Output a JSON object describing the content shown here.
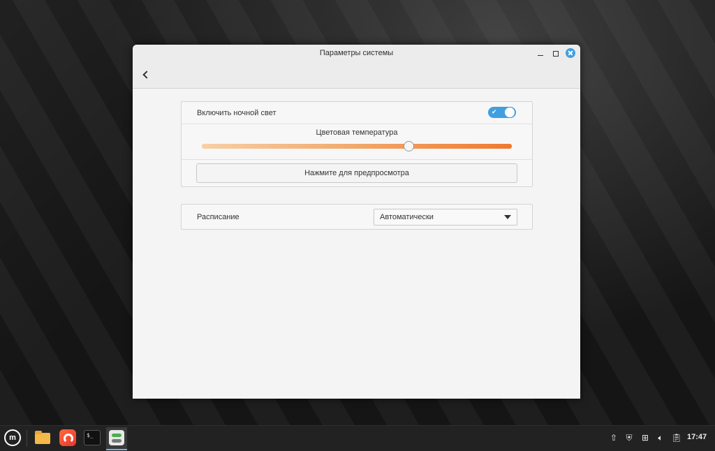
{
  "window": {
    "title": "Параметры системы",
    "minimize_icon": "minimize-icon",
    "maximize_icon": "maximize-icon",
    "close_icon": "close-icon",
    "back_icon": "chevron-left-icon"
  },
  "night_light": {
    "enable_label": "Включить ночной свет",
    "enabled": true,
    "toggle_check_icon": "✔",
    "temperature_title": "Цветовая температура",
    "temperature_fraction": 0.667,
    "preview_button": "Нажмите для предпросмотра"
  },
  "schedule": {
    "label": "Расписание",
    "selected": "Автоматически"
  },
  "taskbar": {
    "menu_logo": "m",
    "terminal_prompt": "$_",
    "apps": [
      "menu-icon",
      "files-icon",
      "firefox-icon",
      "terminal-icon",
      "system-settings-icon"
    ],
    "tray_icons": [
      "update-icon",
      "shield-icon",
      "network-icon",
      "volume-icon",
      "clipboard-icon"
    ],
    "clock": "17:47"
  },
  "colors": {
    "accent": "#3f9fe0",
    "slider_start": "#f7cfa8",
    "slider_end": "#ef7a2f"
  }
}
